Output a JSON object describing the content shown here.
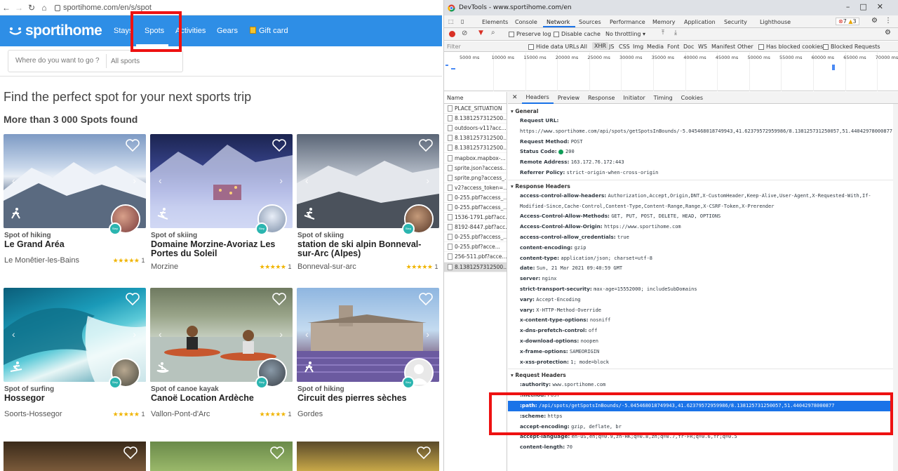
{
  "browser": {
    "url": "sportihome.com/en/s/spot"
  },
  "site": {
    "logo": "sportihome",
    "nav": [
      {
        "label": "Stays"
      },
      {
        "label": "Spots"
      },
      {
        "label": "Activities"
      },
      {
        "label": "Gears"
      },
      {
        "label": "Gift card"
      }
    ],
    "search_placeholder": "Where do you want to go ?",
    "sport_filter": "All sports",
    "heading": "Find the perfect spot for your next sports trip",
    "count": "More than 3 000 Spots found",
    "cards": [
      {
        "type": "Spot of hiking",
        "title": "Le Grand Aréa",
        "location": "Le Monêtier-les-Bains",
        "rating": "1",
        "stars": "★★★★★"
      },
      {
        "type": "Spot of skiing",
        "title": "Domaine Morzine-Avoriaz Les Portes du Soleil",
        "location": "Morzine",
        "rating": "1",
        "stars": "★★★★★"
      },
      {
        "type": "Spot of skiing",
        "title": "station de ski alpin Bonneval-sur-Arc (Alpes)",
        "location": "Bonneval-sur-arc",
        "rating": "1",
        "stars": "★★★★★"
      },
      {
        "type": "Spot of surfing",
        "title": "Hossegor",
        "location": "Soorts-Hossegor",
        "rating": "1",
        "stars": "★★★★★"
      },
      {
        "type": "Spot of canoe kayak",
        "title": "Canoë Location Ardèche",
        "location": "Vallon-Pont-d'Arc",
        "rating": "1",
        "stars": "★★★★★"
      },
      {
        "type": "Spot of hiking",
        "title": "Circuit des pierres sèches",
        "location": "Gordes",
        "rating": "",
        "stars": ""
      }
    ],
    "badge_text": "Step Share"
  },
  "devtools": {
    "title": "DevTools - www.sportihome.com/en",
    "tabs": [
      "Elements",
      "Console",
      "Network",
      "Sources",
      "Performance",
      "Memory",
      "Application",
      "Security",
      "Lighthouse"
    ],
    "active_tab": "Network",
    "errors": "7",
    "warnings": "3",
    "toolbar": {
      "preserve_log": "Preserve log",
      "disable_cache": "Disable cache",
      "throttling": "No throttling"
    },
    "filter": {
      "placeholder": "Filter",
      "hide_data_urls": "Hide data URLs",
      "types": [
        "All",
        "XHR",
        "JS",
        "CSS",
        "Img",
        "Media",
        "Font",
        "Doc",
        "WS",
        "Manifest",
        "Other"
      ],
      "has_blocked_cookies": "Has blocked cookies",
      "blocked_requests": "Blocked Requests"
    },
    "timeline_ticks": [
      "5000 ms",
      "10000 ms",
      "15000 ms",
      "20000 ms",
      "25000 ms",
      "30000 ms",
      "35000 ms",
      "40000 ms",
      "45000 ms",
      "50000 ms",
      "55000 ms",
      "60000 ms",
      "65000 ms",
      "70000 ms"
    ],
    "name_header": "Name",
    "requests": [
      "PLACE_SITUATION",
      "8.1381257312500...",
      "outdoors-v11?acc...",
      "8.1381257312500...",
      "8.1381257312500...",
      "mapbox.mapbox-...",
      "sprite.json?access...",
      "sprite.png?access_...",
      "v2?access_token=...",
      "0-255.pbf?access_...",
      "0-255.pbf?access_...",
      "1536-1791.pbf?acc...",
      "8192-8447.pbf?acc...",
      "0-255.pbf?access_...",
      "0-255.pbf?acce...",
      "256-511.pbf?acce...",
      "8.1381257312500..."
    ],
    "detail_tabs": [
      "Headers",
      "Preview",
      "Response",
      "Initiator",
      "Timing",
      "Cookies"
    ],
    "general_title": "General",
    "general": [
      {
        "k": "Request URL:",
        "v": "https://www.sportihome.com/api/spots/getSpotsInBounds/-5.045468018749943,41.62379572959986/8.138125731250057,51.44042978000877"
      },
      {
        "k": "Request Method:",
        "v": "POST"
      },
      {
        "k": "Status Code:",
        "v": "200"
      },
      {
        "k": "Remote Address:",
        "v": "163.172.76.172:443"
      },
      {
        "k": "Referrer Policy:",
        "v": "strict-origin-when-cross-origin"
      }
    ],
    "response_title": "Response Headers",
    "response": [
      {
        "k": "access-control-allow-headers:",
        "v": "Authorization,Accept,Origin,DNT,X-CustomHeader,Keep-Alive,User-Agent,X-Requested-With,If-Modified-Since,Cache-Control,Content-Type,Content-Range,Range,X-CSRF-Token,X-Prerender"
      },
      {
        "k": "Access-Control-Allow-Methods:",
        "v": "GET, PUT, POST, DELETE, HEAD, OPTIONS"
      },
      {
        "k": "Access-Control-Allow-Origin:",
        "v": "https://www.sportihome.com"
      },
      {
        "k": "access-control-allow_credentials:",
        "v": "true"
      },
      {
        "k": "content-encoding:",
        "v": "gzip"
      },
      {
        "k": "content-type:",
        "v": "application/json; charset=utf-8"
      },
      {
        "k": "date:",
        "v": "Sun, 21 Mar 2021 09:40:59 GMT"
      },
      {
        "k": "server:",
        "v": "nginx"
      },
      {
        "k": "strict-transport-security:",
        "v": "max-age=15552000; includeSubDomains"
      },
      {
        "k": "vary:",
        "v": "Accept-Encoding"
      },
      {
        "k": "vary:",
        "v": "X-HTTP-Method-Override"
      },
      {
        "k": "x-content-type-options:",
        "v": "nosniff"
      },
      {
        "k": "x-dns-prefetch-control:",
        "v": "off"
      },
      {
        "k": "x-download-options:",
        "v": "noopen"
      },
      {
        "k": "x-frame-options:",
        "v": "SAMEORIGIN"
      },
      {
        "k": "x-xss-protection:",
        "v": "1; mode=block"
      }
    ],
    "request_title": "Request Headers",
    "request": [
      {
        "k": ":authority:",
        "v": "www.sportihome.com"
      },
      {
        "k": ":method:",
        "v": "POST"
      },
      {
        "k": ":path:",
        "v": "/api/spots/getSpotsInBounds/-5.045468018749943,41.62379572959986/8.138125731250057,51.44042978000877"
      },
      {
        "k": ":scheme:",
        "v": "https"
      },
      {
        "k": "accept-encoding:",
        "v": "gzip, deflate, br"
      },
      {
        "k": "accept-language:",
        "v": "en-US,en;q=0.9,zh-HK;q=0.8,zh;q=0.7,fr-FR;q=0.6,fr;q=0.5"
      },
      {
        "k": "content-length:",
        "v": "70"
      }
    ]
  },
  "colors": {
    "brand": "#2e8ee6",
    "highlight": "#1a73e8",
    "annotation": "#e11111",
    "star": "#f0b400"
  }
}
